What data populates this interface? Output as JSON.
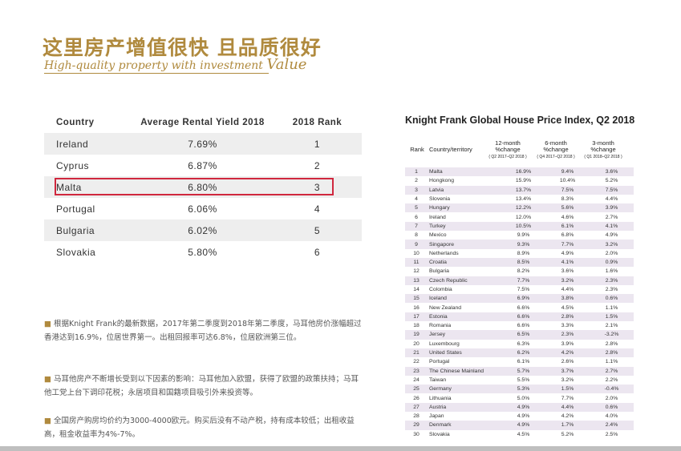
{
  "header": {
    "title_cn": "这里房产增值很快 且品质很好",
    "title_en_main": "High-quality property with investment ",
    "title_en_big": "Value"
  },
  "yield_table": {
    "headers": [
      "Country",
      "Average Rental Yield 2018",
      "2018 Rank"
    ],
    "rows": [
      {
        "country": "Ireland",
        "yield": "7.69%",
        "rank": "1"
      },
      {
        "country": "Cyprus",
        "yield": "6.87%",
        "rank": "2"
      },
      {
        "country": "Malta",
        "yield": "6.80%",
        "rank": "3"
      },
      {
        "country": "Portugal",
        "yield": "6.06%",
        "rank": "4"
      },
      {
        "country": "Bulgaria",
        "yield": "6.02%",
        "rank": "5"
      },
      {
        "country": "Slovakia",
        "yield": "5.80%",
        "rank": "6"
      }
    ],
    "highlight_color": "#d0273e"
  },
  "bullets": [
    "根据Knight Frank的最新数据，2017年第二季度到2018年第二季度，马耳他房价涨幅超过香港达到16.9%，位居世界第一。出租回报率可达6.8%，位居欧洲第三位。",
    "马耳他房产不断增长受到以下因素的影响：马耳他加入欧盟，获得了欧盟的政策扶持；马耳他工党上台下调印花税；永居项目和国籍项目吸引外来投资等。",
    "全国房产购房均价约为3000-4000欧元。购买后没有不动产税，持有成本较低；出租收益高，租金收益率为4%-7%。"
  ],
  "kf_index": {
    "title": "Knight Frank Global House Price Index, Q2 2018",
    "headers": {
      "rank": "Rank",
      "country": "Country/territory",
      "c12": "12-month\n%change",
      "c12_sub": "( Q2 2017–Q2 2018 )",
      "c6": "6-month\n%change",
      "c6_sub": "( Q4 2017–Q2 2018 )",
      "c3": "3-month\n%change",
      "c3_sub": "( Q1 2018–Q2 2018 )"
    },
    "shade_color": "#ece6f0",
    "rows": [
      [
        "1",
        "Malta",
        "16.9%",
        "9.4%",
        "3.6%"
      ],
      [
        "2",
        "Hongkong",
        "15.9%",
        "10.4%",
        "5.2%"
      ],
      [
        "3",
        "Latvia",
        "13.7%",
        "7.5%",
        "7.5%"
      ],
      [
        "4",
        "Slovenia",
        "13.4%",
        "8.3%",
        "4.4%"
      ],
      [
        "5",
        "Hungary",
        "12.2%",
        "5.6%",
        "3.9%"
      ],
      [
        "6",
        "Ireland",
        "12.0%",
        "4.6%",
        "2.7%"
      ],
      [
        "7",
        "Turkey",
        "10.5%",
        "6.1%",
        "4.1%"
      ],
      [
        "8",
        "Mexico",
        "9.9%",
        "6.8%",
        "4.9%"
      ],
      [
        "9",
        "Singapore",
        "9.3%",
        "7.7%",
        "3.2%"
      ],
      [
        "10",
        "Netherlands",
        "8.9%",
        "4.9%",
        "2.0%"
      ],
      [
        "11",
        "Croatia",
        "8.5%",
        "4.1%",
        "0.9%"
      ],
      [
        "12",
        "Bulgaria",
        "8.2%",
        "3.6%",
        "1.6%"
      ],
      [
        "13",
        "Czech Republic",
        "7.7%",
        "3.2%",
        "2.3%"
      ],
      [
        "14",
        "Colombia",
        "7.5%",
        "4.4%",
        "2.3%"
      ],
      [
        "15",
        "Iceland",
        "6.9%",
        "3.8%",
        "0.6%"
      ],
      [
        "16",
        "New Zealand",
        "6.6%",
        "4.5%",
        "1.1%"
      ],
      [
        "17",
        "Estonia",
        "6.6%",
        "2.8%",
        "1.5%"
      ],
      [
        "18",
        "Romania",
        "6.6%",
        "3.3%",
        "2.1%"
      ],
      [
        "19",
        "Jersey",
        "6.5%",
        "2.3%",
        "-3.2%"
      ],
      [
        "20",
        "Luxembourg",
        "6.3%",
        "3.9%",
        "2.8%"
      ],
      [
        "21",
        "United States",
        "6.2%",
        "4.2%",
        "2.8%"
      ],
      [
        "22",
        "Portugal",
        "6.1%",
        "2.6%",
        "1.1%"
      ],
      [
        "23",
        "The Chinese Mainland",
        "5.7%",
        "3.7%",
        "2.7%"
      ],
      [
        "24",
        "Taiwan",
        "5.5%",
        "3.2%",
        "2.2%"
      ],
      [
        "25",
        "Germany",
        "5.3%",
        "1.5%",
        "-0.4%"
      ],
      [
        "26",
        "Lithuania",
        "5.0%",
        "7.7%",
        "2.0%"
      ],
      [
        "27",
        "Austria",
        "4.9%",
        "4.4%",
        "0.6%"
      ],
      [
        "28",
        "Japan",
        "4.9%",
        "4.2%",
        "4.0%"
      ],
      [
        "29",
        "Denmark",
        "4.9%",
        "1.7%",
        "2.4%"
      ],
      [
        "30",
        "Slovakia",
        "4.5%",
        "5.2%",
        "2.5%"
      ]
    ]
  }
}
